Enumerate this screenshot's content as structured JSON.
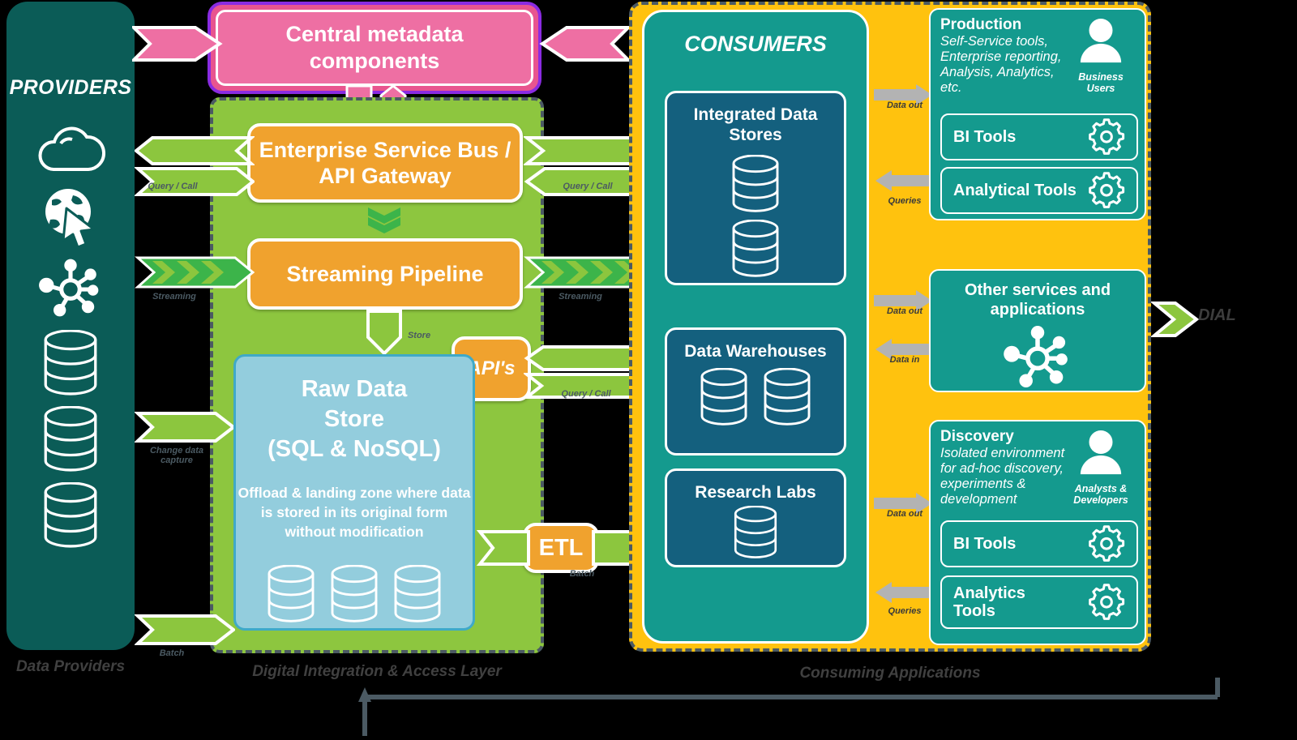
{
  "providers": {
    "title": "PROVIDERS",
    "footer": "Data Providers",
    "icons": [
      "cloud-icon",
      "web-click-icon",
      "network-hub-icon",
      "database-cylinder-icon",
      "database-cylinder-icon",
      "database-cylinder-icon"
    ]
  },
  "metadata": {
    "label": "Central metadata components"
  },
  "dial": {
    "footer": "Digital Integration & Access Layer",
    "final_label": "DIAL",
    "esb": "Enterprise Service Bus / API Gateway",
    "streaming": "Streaming Pipeline",
    "apis": "API's",
    "etl": "ETL",
    "store_label": "Store",
    "raw_title": "Raw Data Store (SQL & NoSQL)",
    "raw_title_lines": [
      "Raw Data",
      "Store",
      "(SQL & NoSQL)"
    ],
    "raw_desc": "Offload & landing zone where data is stored in its original form without modification"
  },
  "arrow_labels": {
    "query_call_left": "Query / Call",
    "query_call_right": "Query / Call",
    "query_call_apis": "Query / Call",
    "streaming_left": "Streaming",
    "streaming_right": "Streaming",
    "change_data_capture": "Change data capture",
    "batch_left": "Batch",
    "batch_etl": "Batch",
    "data_out": "Data out",
    "data_in": "Data in",
    "queries": "Queries"
  },
  "consumers": {
    "title": "CONSUMERS",
    "cards": [
      {
        "title": "Integrated Data Stores",
        "cylinders": 2
      },
      {
        "title": "Data Warehouses",
        "cylinders": 2
      },
      {
        "title": "Research Labs",
        "cylinders": 1
      }
    ]
  },
  "consuming_apps": {
    "footer": "Consuming Applications",
    "production": {
      "name": "Production",
      "desc": "Self-Service tools, Enterprise reporting, Analysis, Analytics, etc.",
      "persona": "Business Users",
      "persona_icon": "user-avatar-icon",
      "tools": [
        {
          "label": "BI Tools",
          "icon": "gear-icon"
        },
        {
          "label": "Analytical Tools",
          "icon": "gear-icon"
        }
      ]
    },
    "other": {
      "title": "Other services and applications",
      "icon": "network-hub-icon"
    },
    "discovery": {
      "name": "Discovery",
      "desc": "Isolated environment for ad-hoc discovery, experiments & development",
      "persona": "Analysts & Developers",
      "persona_icon": "user-avatar-icon",
      "tools": [
        {
          "label": "BI Tools",
          "icon": "gear-icon"
        },
        {
          "label": "Analytics Tools",
          "icon": "gear-icon"
        }
      ]
    }
  },
  "colors": {
    "providers_panel": "#0B5C57",
    "metadata_fill": "#EE6FA3",
    "metadata_border": "#8A2BE2",
    "dial_green": "#8DC63F",
    "orange": "#F0A22E",
    "raw_blue": "#93CDDD",
    "yellow": "#FFC20E",
    "teal": "#149A8E",
    "dark_card": "#14607E",
    "arrow_green": "#8CC63E",
    "gray_arrow": "#B3B3B3",
    "pink_arrow": "#EE6FA3"
  }
}
